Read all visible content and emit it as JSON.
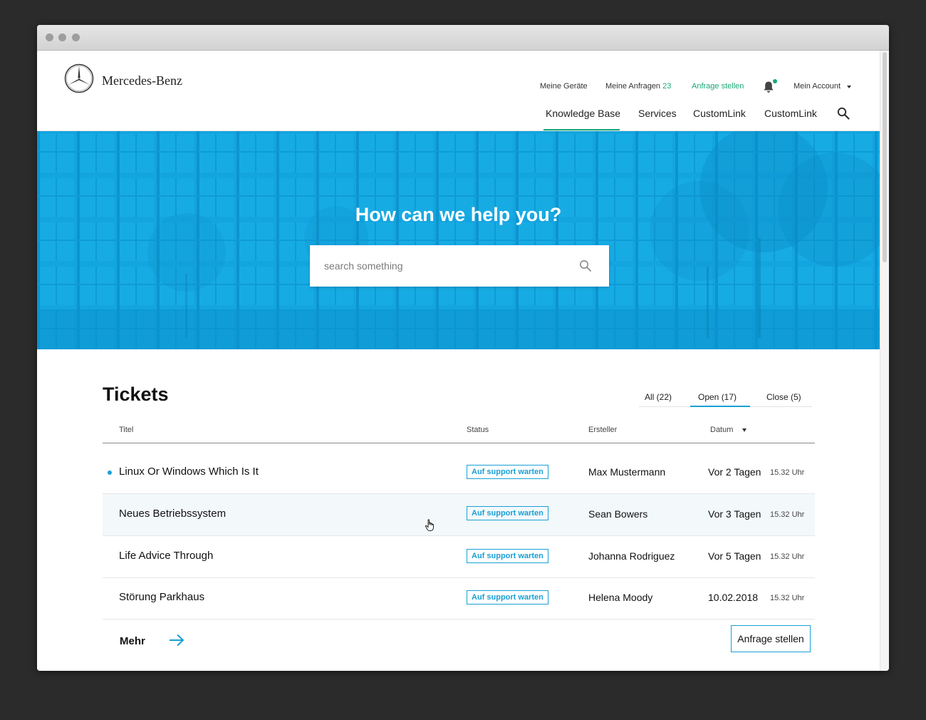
{
  "header": {
    "brand": "Mercedes-Benz",
    "top_links": {
      "devices": "Meine Geräte",
      "requests": "Meine Anfragen",
      "requests_count": "23",
      "new_request": "Anfrage stellen",
      "account": "Mein Account"
    },
    "nav": [
      "Knowledge Base",
      "Services",
      "CustomLink",
      "CustomLink"
    ]
  },
  "hero": {
    "title": "How can we help you?",
    "search_placeholder": "search something"
  },
  "tickets": {
    "title": "Tickets",
    "filters": [
      "All (22)",
      "Open (17)",
      "Close (5)"
    ],
    "active_filter": "Open (17)",
    "columns": [
      "Titel",
      "Status",
      "Ersteller",
      "Datum"
    ],
    "rows": [
      {
        "title": "Linux Or Windows Which Is It",
        "status": "Auf support warten",
        "creator": "Max Mustermann",
        "date": "Vor 2 Tagen",
        "time": "15.32 Uhr",
        "unread": true
      },
      {
        "title": "Neues Betriebssystem",
        "status": "Auf support warten",
        "creator": "Sean Bowers",
        "date": "Vor 3 Tagen",
        "time": "15.32 Uhr",
        "unread": false
      },
      {
        "title": "Life Advice Through",
        "status": "Auf support warten",
        "creator": "Johanna Rodriguez",
        "date": "Vor 5 Tagen",
        "time": "15.32 Uhr",
        "unread": false
      },
      {
        "title": "Störung Parkhaus",
        "status": "Auf support warten",
        "creator": "Helena Moody",
        "date": "10.02.2018",
        "time": "15.32 Uhr",
        "unread": false
      }
    ],
    "more": "Mehr",
    "cta": "Anfrage stellen"
  },
  "colors": {
    "accent_green": "#19a974",
    "accent_blue": "#19a0d5",
    "hero_blue": "#0fa3df"
  },
  "icons": [
    "mercedes-star-icon",
    "bell-icon",
    "search-icon",
    "arrow-right-icon",
    "hand-cursor-icon"
  ]
}
